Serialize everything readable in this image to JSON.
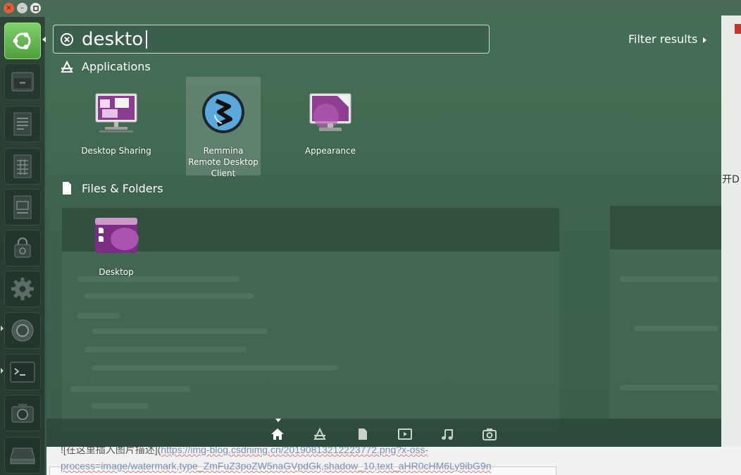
{
  "window_controls": {
    "close_glyph": "×",
    "min_glyph": "–"
  },
  "search": {
    "query": "deskto",
    "filter_label": "Filter results"
  },
  "sections": {
    "applications": {
      "heading": "Applications",
      "items": [
        {
          "label": "Desktop Sharing",
          "icon": "desktop-sharing-icon"
        },
        {
          "label": "Remmina Remote Desktop Client",
          "icon": "remmina-icon"
        },
        {
          "label": "Appearance",
          "icon": "appearance-icon"
        }
      ]
    },
    "files": {
      "heading": "Files & Folders",
      "items": [
        {
          "label": "Desktop",
          "icon": "folder-icon"
        }
      ]
    }
  },
  "lenses": [
    "home-lens-icon",
    "applications-lens-icon",
    "files-lens-icon",
    "video-lens-icon",
    "music-lens-icon",
    "photo-lens-icon"
  ],
  "background": {
    "line1_prefix": "![在这里插入图片描述](",
    "line1_link": "https://img-blog.csdnimg.cn/20190813212223772.png?x-oss-",
    "line2": "process=image/watermark,type_ZmFuZ3poZW5naGVpdGk,shadow_10,text_aHR0cHM6Ly9ibG9n",
    "right_cn": "开D"
  },
  "colors": {
    "accent": "#4f9f3e",
    "purple": "#9b4f9e"
  }
}
